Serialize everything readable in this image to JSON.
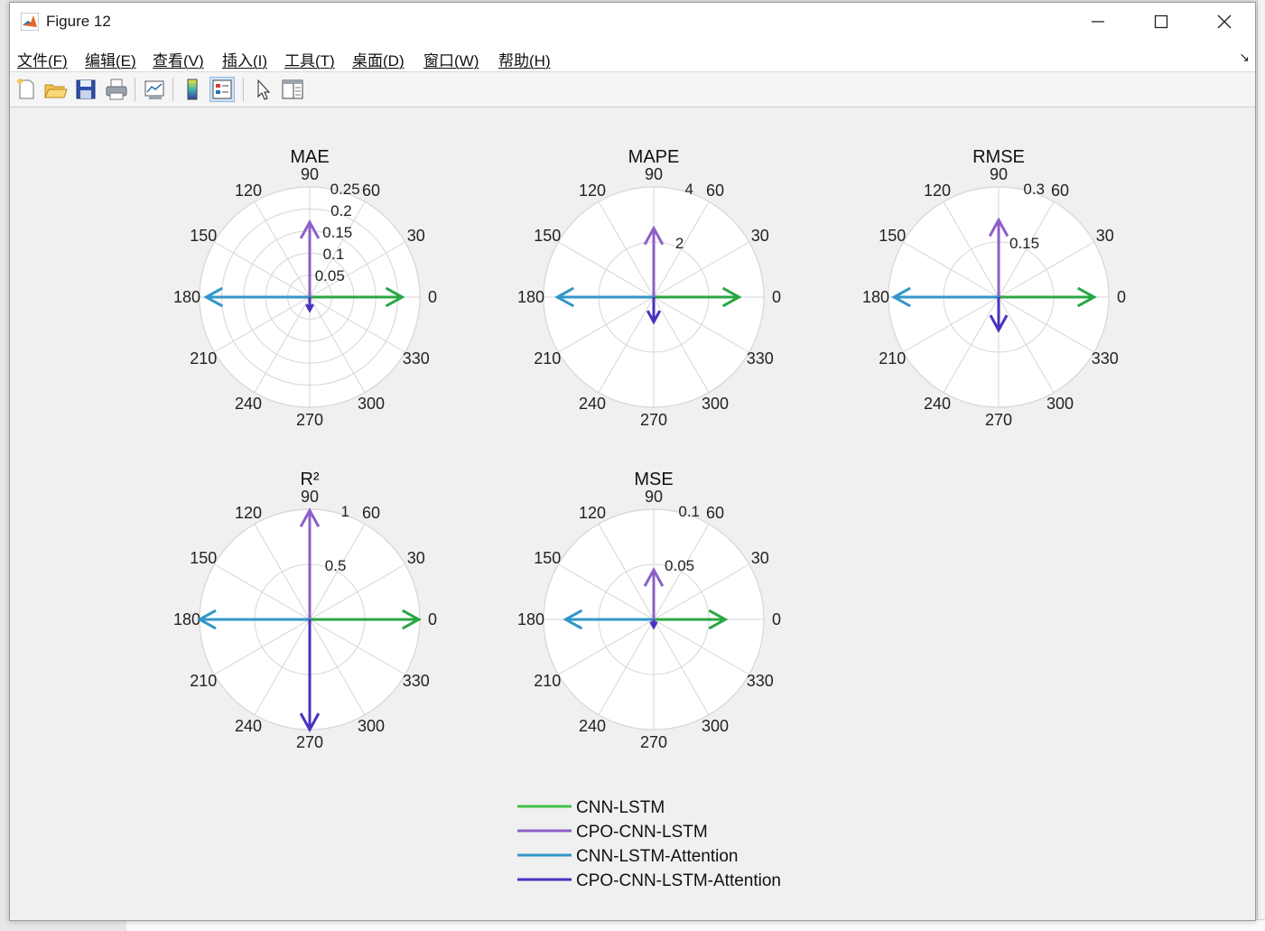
{
  "window": {
    "title": "Figure 12",
    "minimize_icon": "minimize-icon",
    "maximize_icon": "maximize-icon",
    "close_icon": "close-icon"
  },
  "menu": [
    "文件(F)",
    "编辑(E)",
    "查看(V)",
    "插入(I)",
    "工具(T)",
    "桌面(D)",
    "窗口(W)",
    "帮助(H)"
  ],
  "toolbar": [
    "new-figure-icon",
    "open-file-icon",
    "save-icon",
    "print-icon",
    "link-plot-icon",
    "colorbar-icon",
    "legend-icon",
    "pointer-icon",
    "property-editor-icon"
  ],
  "angle_labels": [
    "0",
    "30",
    "60",
    "90",
    "120",
    "150",
    "180",
    "210",
    "240",
    "270",
    "300",
    "330"
  ],
  "series_colors": {
    "CNN-LSTM": "#2aa745",
    "CPO-CNN-LSTM": "#8e5fc8",
    "CNN-LSTM-Attention": "#3396c8",
    "CPO-CNN-LSTM-Attention": "#4a32c0"
  },
  "legend": {
    "entries": [
      {
        "label": "CNN-LSTM",
        "color": "#3fc24a"
      },
      {
        "label": "CPO-CNN-LSTM",
        "color": "#8e5fc8"
      },
      {
        "label": "CNN-LSTM-Attention",
        "color": "#3396c8"
      },
      {
        "label": "CPO-CNN-LSTM-Attention",
        "color": "#4a32c0"
      }
    ]
  },
  "chart_data": [
    {
      "type": "polar-compass",
      "title": "MAE",
      "rmax": 0.25,
      "rticks": [
        "0.05",
        "0.1",
        "0.15",
        "0.2",
        "0.25"
      ],
      "theta_ticks_deg": [
        0,
        30,
        60,
        90,
        120,
        150,
        180,
        210,
        240,
        270,
        300,
        330
      ],
      "series": [
        {
          "name": "CNN-LSTM",
          "angle": 0,
          "value": 0.21
        },
        {
          "name": "CPO-CNN-LSTM",
          "angle": 90,
          "value": 0.17
        },
        {
          "name": "CNN-LSTM-Attention",
          "angle": 180,
          "value": 0.235
        },
        {
          "name": "CPO-CNN-LSTM-Attention",
          "angle": 270,
          "value": 0.03
        }
      ]
    },
    {
      "type": "polar-compass",
      "title": "MAPE",
      "rmax": 4,
      "rticks": [
        "2",
        "4"
      ],
      "theta_ticks_deg": [
        0,
        30,
        60,
        90,
        120,
        150,
        180,
        210,
        240,
        270,
        300,
        330
      ],
      "series": [
        {
          "name": "CNN-LSTM",
          "angle": 0,
          "value": 3.1
        },
        {
          "name": "CPO-CNN-LSTM",
          "angle": 90,
          "value": 2.5
        },
        {
          "name": "CNN-LSTM-Attention",
          "angle": 180,
          "value": 3.5
        },
        {
          "name": "CPO-CNN-LSTM-Attention",
          "angle": 270,
          "value": 0.9
        }
      ]
    },
    {
      "type": "polar-compass",
      "title": "RMSE",
      "rmax": 0.3,
      "rticks": [
        "0.15",
        "0.3"
      ],
      "theta_ticks_deg": [
        0,
        30,
        60,
        90,
        120,
        150,
        180,
        210,
        240,
        270,
        300,
        330
      ],
      "series": [
        {
          "name": "CNN-LSTM",
          "angle": 0,
          "value": 0.26
        },
        {
          "name": "CPO-CNN-LSTM",
          "angle": 90,
          "value": 0.21
        },
        {
          "name": "CNN-LSTM-Attention",
          "angle": 180,
          "value": 0.285
        },
        {
          "name": "CPO-CNN-LSTM-Attention",
          "angle": 270,
          "value": 0.09
        }
      ]
    },
    {
      "type": "polar-compass",
      "title": "R²",
      "rmax": 1,
      "rticks": [
        "0.5",
        "1"
      ],
      "theta_ticks_deg": [
        0,
        30,
        60,
        90,
        120,
        150,
        180,
        210,
        240,
        270,
        300,
        330
      ],
      "series": [
        {
          "name": "CNN-LSTM",
          "angle": 0,
          "value": 0.99
        },
        {
          "name": "CPO-CNN-LSTM",
          "angle": 90,
          "value": 0.99
        },
        {
          "name": "CNN-LSTM-Attention",
          "angle": 180,
          "value": 1.0
        },
        {
          "name": "CPO-CNN-LSTM-Attention",
          "angle": 270,
          "value": 1.0
        }
      ]
    },
    {
      "type": "polar-compass",
      "title": "MSE",
      "rmax": 0.1,
      "rticks": [
        "0.05",
        "0.1"
      ],
      "theta_ticks_deg": [
        0,
        30,
        60,
        90,
        120,
        150,
        180,
        210,
        240,
        270,
        300,
        330
      ],
      "series": [
        {
          "name": "CNN-LSTM",
          "angle": 0,
          "value": 0.065
        },
        {
          "name": "CPO-CNN-LSTM",
          "angle": 90,
          "value": 0.045
        },
        {
          "name": "CNN-LSTM-Attention",
          "angle": 180,
          "value": 0.08
        },
        {
          "name": "CPO-CNN-LSTM-Attention",
          "angle": 270,
          "value": 0.007
        }
      ]
    }
  ]
}
